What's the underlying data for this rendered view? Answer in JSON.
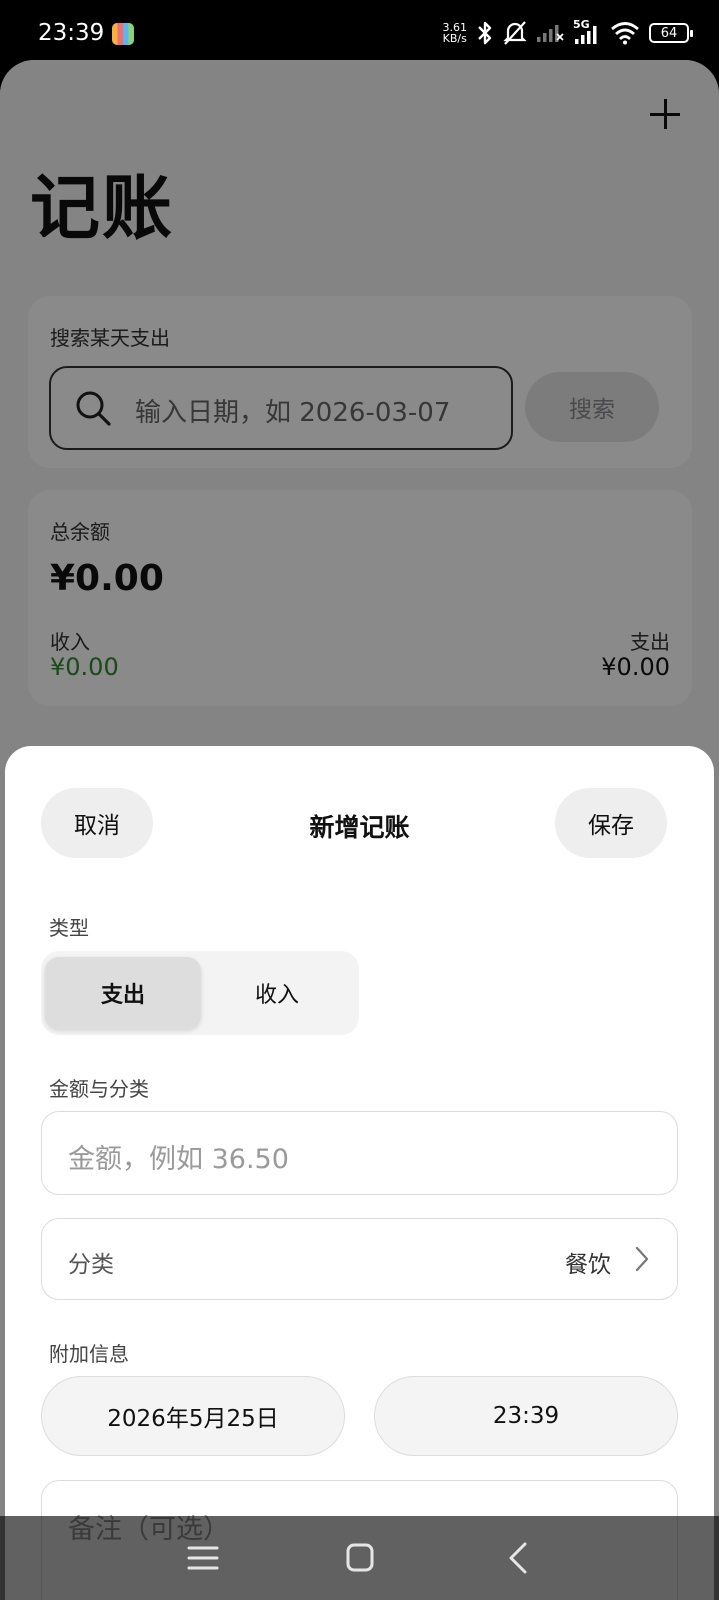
{
  "status_bar": {
    "time": "23:39",
    "net_speed_value": "3.61",
    "net_speed_unit": "KB/s",
    "network_type": "5G",
    "battery": "64",
    "icons": [
      "app-icon",
      "bluetooth-icon",
      "bell-off-icon",
      "signal-off-icon",
      "signal-icon",
      "wifi-icon",
      "battery-icon"
    ]
  },
  "main": {
    "title": "记账",
    "add_icon": "plus-icon",
    "search": {
      "label": "搜索某天支出",
      "placeholder": "输入日期，如 2026-03-07",
      "button": "搜索"
    },
    "balance": {
      "label": "总余额",
      "amount": "¥0.00",
      "income_label": "收入",
      "income_value": "¥0.00",
      "expense_label": "支出",
      "expense_value": "¥0.00",
      "income_color": "#2f8a2f"
    }
  },
  "sheet": {
    "cancel": "取消",
    "title": "新增记账",
    "save": "保存",
    "type_label": "类型",
    "type_options": [
      "支出",
      "收入"
    ],
    "type_selected": "支出",
    "amount_section_label": "金额与分类",
    "amount_placeholder": "金额，例如 36.50",
    "category_label": "分类",
    "category_value": "餐饮",
    "extra_section_label": "附加信息",
    "date": "2026年5月25日",
    "time": "23:39",
    "note_placeholder": "备注（可选）"
  },
  "nav": {
    "icons": [
      "menu-icon",
      "home-icon",
      "back-icon"
    ]
  }
}
